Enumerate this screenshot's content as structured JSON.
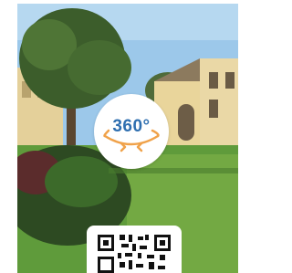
{
  "viewer": {
    "badge_label": "360°",
    "panorama_icon": "360-rotate-icon",
    "qr_icon": "qr-code-icon",
    "colors": {
      "badge_text": "#2f6fb0",
      "badge_arrows": "#f0a24a",
      "sky": "#9cc8ea",
      "grass": "#5f9b3b"
    }
  }
}
